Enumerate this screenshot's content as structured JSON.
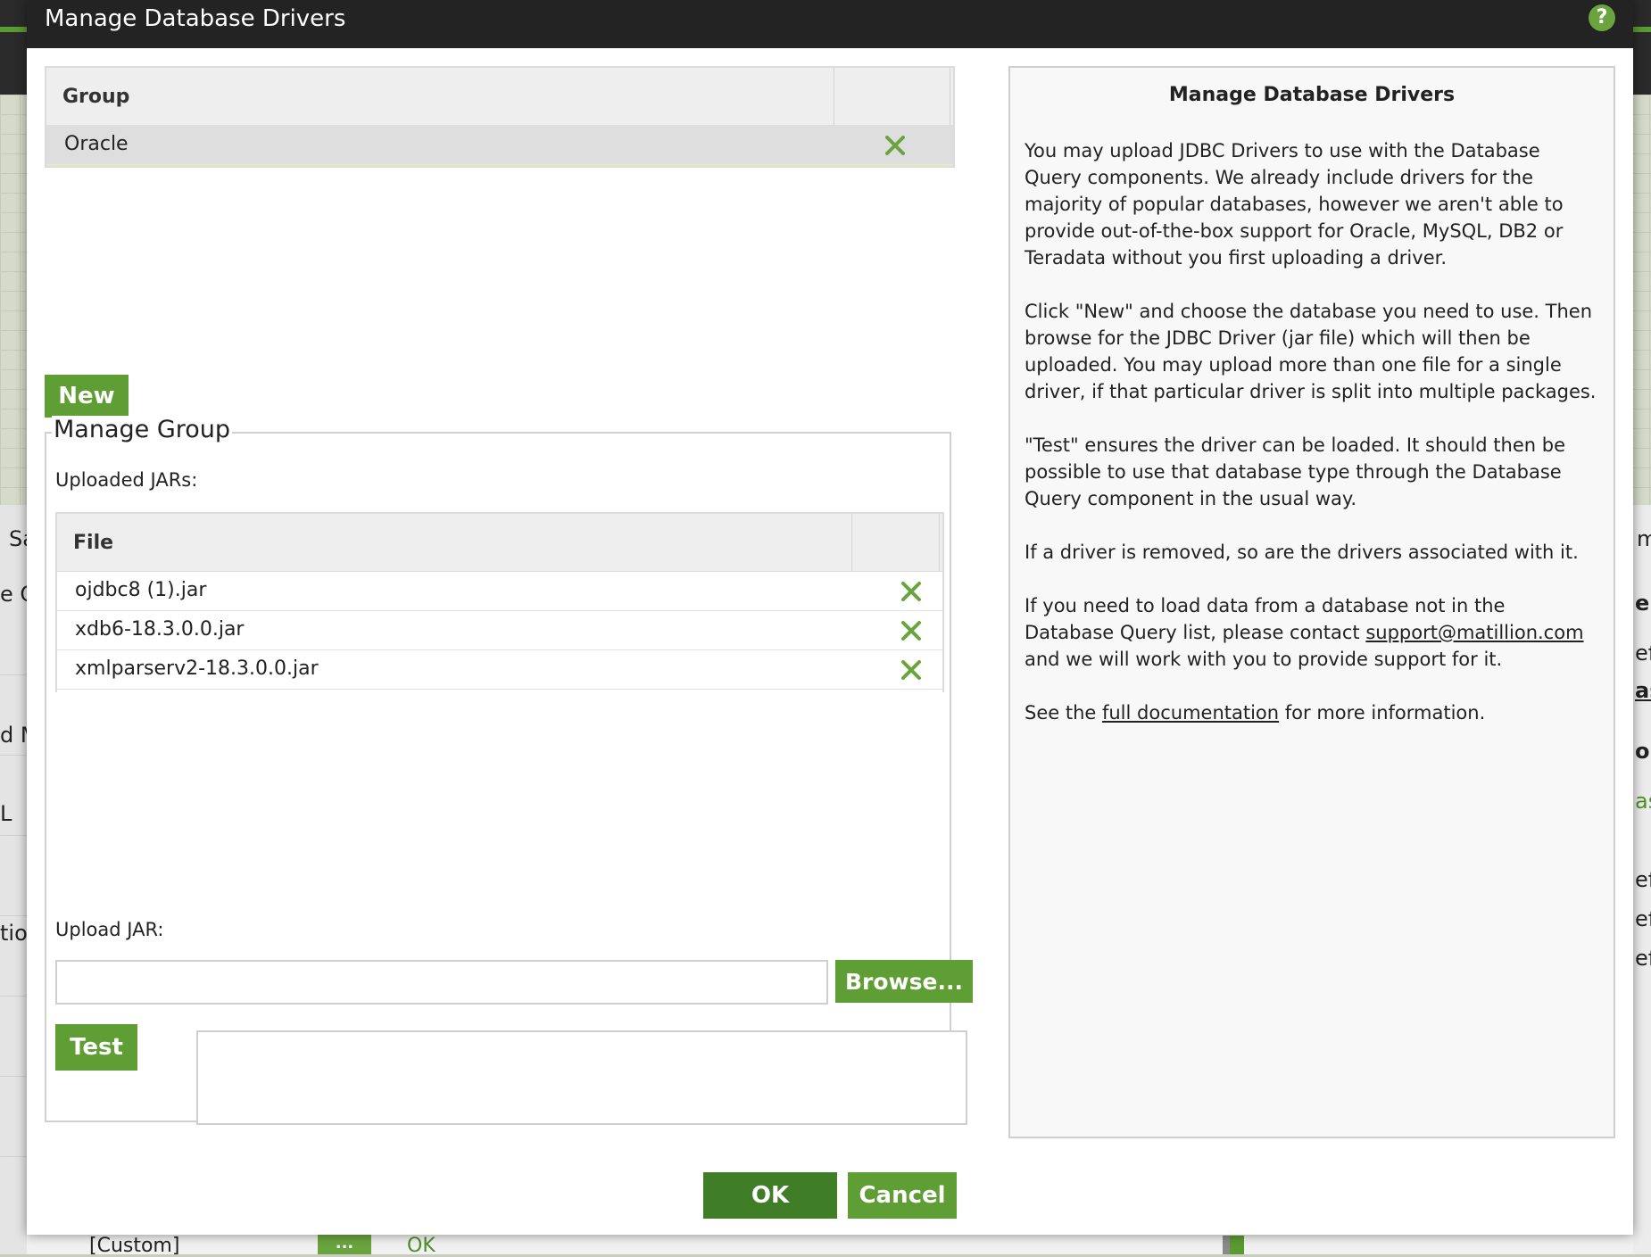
{
  "dialog": {
    "title": "Manage Database Drivers"
  },
  "group_table": {
    "header": "Group",
    "rows": [
      {
        "label": "Oracle",
        "selected": true
      }
    ]
  },
  "new_button": "New",
  "manage_group": {
    "legend": "Manage Group",
    "uploaded_label": "Uploaded JARs:",
    "file_header": "File",
    "files": [
      "ojdbc8 (1).jar",
      "xdb6-18.3.0.0.jar",
      "xmlparserv2-18.3.0.0.jar"
    ],
    "upload_label": "Upload JAR:",
    "upload_value": "",
    "browse_button": "Browse...",
    "test_button": "Test"
  },
  "footer": {
    "ok": "OK",
    "cancel": "Cancel"
  },
  "help": {
    "title": "Manage Database Drivers",
    "p1": "You may upload JDBC Drivers to use with the Database Query components. We already include drivers for the majority of popular databases, however we aren't able to provide out-of-the-box support for Oracle, MySQL, DB2 or Teradata without you first uploading a driver.",
    "p2": "Click \"New\" and choose the database you need to use. Then browse for the JDBC Driver (jar file) which will then be uploaded. You may upload more than one file for a single driver, if that particular driver is split into multiple packages.",
    "p3": "\"Test\" ensures the driver can be loaded. It should then be possible to use that database type through the Database Query component in the usual way.",
    "p4": "If a driver is removed, so are the drivers associated with it.",
    "p5_before": "If you need to load data from a database not in the Database Query list, please contact ",
    "p5_link": "support@matillion.com",
    "p5_after": " and we will work with you to provide support for it.",
    "p6_before": "See the ",
    "p6_link": "full documentation",
    "p6_after": " for more information."
  },
  "background": {
    "left_fragments": [
      "Sa",
      "e Q",
      "d M",
      "L",
      "tio"
    ],
    "right_fragments": [
      "m",
      "ers",
      "efa",
      "as",
      "on",
      "as",
      "efa",
      "efa",
      "efa"
    ],
    "bottom_row": {
      "value": "[Custom]",
      "button": "...",
      "status": "OK"
    }
  },
  "colors": {
    "accent_green": "#5f9e34",
    "dark_green": "#3f7d27",
    "titlebar": "#232323"
  }
}
